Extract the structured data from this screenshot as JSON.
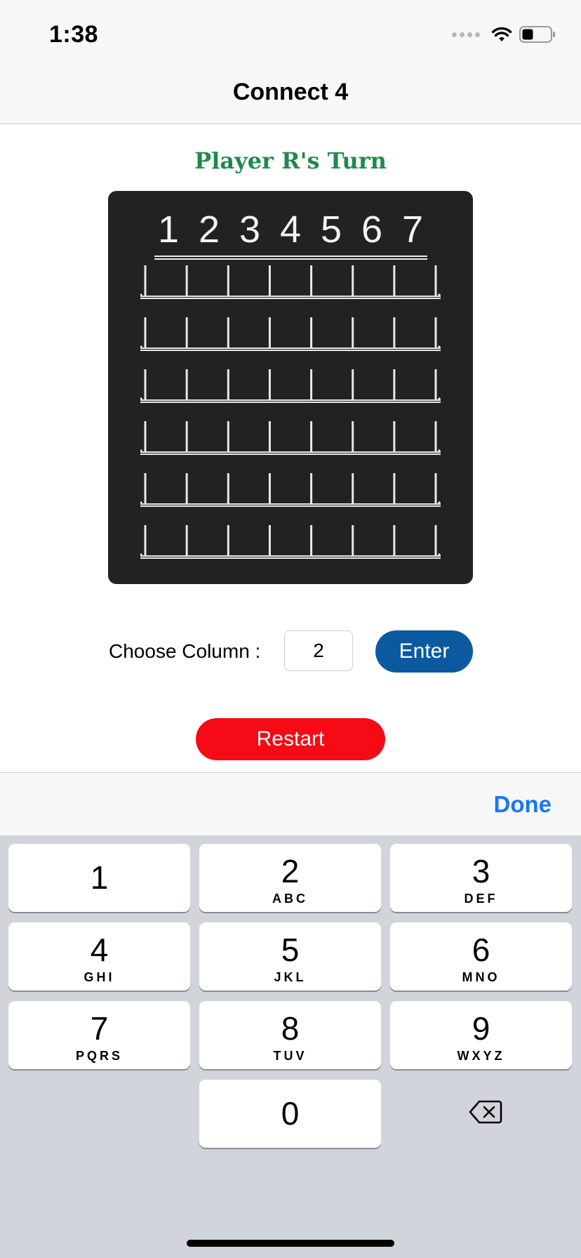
{
  "status_bar": {
    "time": "1:38"
  },
  "nav": {
    "title": "Connect 4"
  },
  "game": {
    "turn_text": "Player R's Turn",
    "column_numbers": [
      "1",
      "2",
      "3",
      "4",
      "5",
      "6",
      "7"
    ],
    "rows": 6,
    "columns": 7,
    "colors": {
      "turn_text": "#1f8a4d",
      "board": "#222222"
    }
  },
  "controls": {
    "choose_label": "Choose Column :",
    "column_value": "2",
    "enter_label": "Enter",
    "restart_label": "Restart",
    "colors": {
      "enter": "#0b5aa0",
      "restart": "#f60a15"
    }
  },
  "keyboard": {
    "done_label": "Done",
    "keys": [
      {
        "digit": "1",
        "letters": ""
      },
      {
        "digit": "2",
        "letters": "ABC"
      },
      {
        "digit": "3",
        "letters": "DEF"
      },
      {
        "digit": "4",
        "letters": "GHI"
      },
      {
        "digit": "5",
        "letters": "JKL"
      },
      {
        "digit": "6",
        "letters": "MNO"
      },
      {
        "digit": "7",
        "letters": "PQRS"
      },
      {
        "digit": "8",
        "letters": "TUV"
      },
      {
        "digit": "9",
        "letters": "WXYZ"
      },
      {
        "digit": "0",
        "letters": ""
      }
    ],
    "delete_icon": "backspace-icon"
  }
}
